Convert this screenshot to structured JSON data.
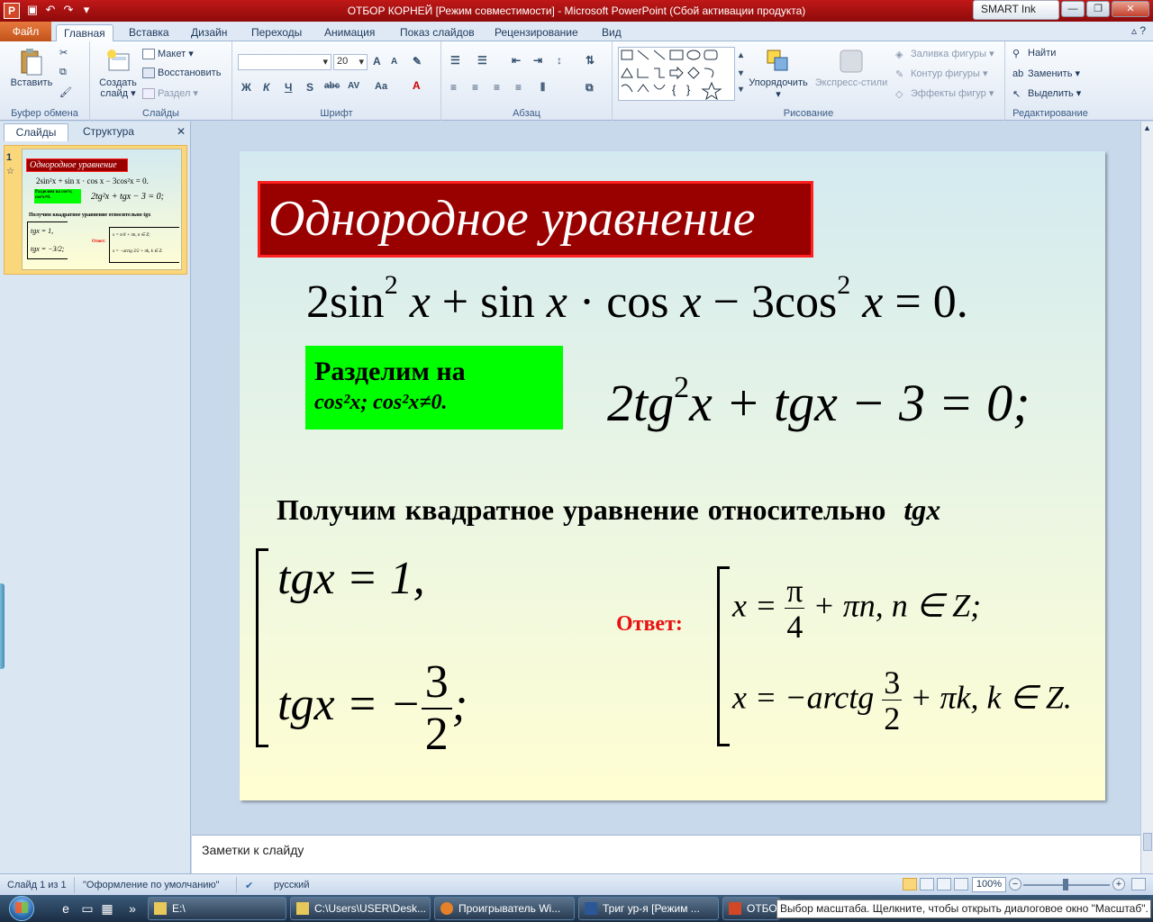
{
  "window": {
    "title": "ОТБОР КОРНЕЙ [Режим совместимости]  -  Microsoft PowerPoint (Сбой активации продукта)",
    "app_icon": "P",
    "smart_ink": "SMART Ink"
  },
  "ribbon_tabs": {
    "file": "Файл",
    "home": "Главная",
    "insert": "Вставка",
    "design": "Дизайн",
    "transitions": "Переходы",
    "animation": "Анимация",
    "slideshow": "Показ слайдов",
    "review": "Рецензирование",
    "view": "Вид"
  },
  "ribbon": {
    "clipboard": {
      "paste": "Вставить",
      "label": "Буфер обмена"
    },
    "slides": {
      "new_slide_1": "Создать",
      "new_slide_2": "слайд",
      "layout": "Макет",
      "reset": "Восстановить",
      "section": "Раздел",
      "label": "Слайды"
    },
    "font": {
      "size": "20",
      "label": "Шрифт",
      "bold": "Ж",
      "italic": "К",
      "underline": "Ч",
      "shadow": "S",
      "strike": "abc",
      "spacing": "AV",
      "case": "Aa",
      "color": "A",
      "grow": "A",
      "shrink": "A"
    },
    "paragraph": {
      "label": "Абзац"
    },
    "drawing": {
      "arrange": "Упорядочить",
      "quick_styles": "Экспресс-стили",
      "fill": "Заливка фигуры",
      "outline": "Контур фигуры",
      "effects": "Эффекты фигур",
      "label": "Рисование"
    },
    "editing": {
      "find": "Найти",
      "replace": "Заменить",
      "select": "Выделить",
      "label": "Редактирование"
    }
  },
  "left_panel": {
    "tab_slides": "Слайды",
    "tab_outline": "Структура",
    "slide_number": "1",
    "thumb": {
      "title": "Однородное  уравнение",
      "eq1": "2sin²x + sin x · cos x − 3cos²x = 0.",
      "green": "Разделим на cos²x; cos²x≠0.",
      "eq2": "2tg²x + tgx − 3 = 0;",
      "line": "Получим квадратное уравнение относительно  tgx",
      "sys1": "tgx = 1,",
      "sys2": "tgx = −3/2;",
      "ans_label": "Ответ:",
      "ans1": "x = π/4 + πn, n ∈ Z;",
      "ans2": "x = −arctg 3/2 + πk, k ∈ Z."
    }
  },
  "slide": {
    "title": "Однородное  уравнение",
    "eq1": {
      "p1": "2sin",
      "exp1": "2",
      "p2": " x",
      "p3": " + sin ",
      "p4": "x",
      "p5": " · cos ",
      "p6": "x",
      "p7": " − 3cos",
      "exp2": "2",
      "p8": " x",
      "p9": " = 0."
    },
    "green_line1": "Разделим на",
    "green_line2": "cos²x; cos²x≠0.",
    "eq2": {
      "p1": "2tg",
      "exp": "2",
      "p2": "x + tgx − 3 = 0;"
    },
    "statement": "Получим квадратное уравнение относительно",
    "statement_var": "tgx",
    "sys1": "tgx = 1,",
    "sys2_left": "tgx = −",
    "sys2_num": "3",
    "sys2_den": "2",
    "sys2_right": ";",
    "answer_label": "Ответ:",
    "ans1_left": "x = ",
    "ans1_num": "π",
    "ans1_den": "4",
    "ans1_right": " + πn, n ∈ Z;",
    "ans2_left": "x = −arctg ",
    "ans2_num": "3",
    "ans2_den": "2",
    "ans2_right": " + πk, k ∈ Z."
  },
  "notes": {
    "placeholder": "Заметки к слайду"
  },
  "statusbar": {
    "slide_info": "Слайд 1 из 1",
    "theme": "\"Оформление по умолчанию\"",
    "language": "русский",
    "zoom": "100%"
  },
  "taskbar": {
    "items": [
      {
        "label": "E:\\"
      },
      {
        "label": "C:\\Users\\USER\\Desk..."
      },
      {
        "label": "Проигрыватель Wi..."
      },
      {
        "label": "Триг ур-я [Режим ..."
      },
      {
        "label": "ОТБО"
      }
    ],
    "tooltip": "Выбор масштаба. Щелкните, чтобы открыть диалоговое окно \"Масштаб\"."
  }
}
